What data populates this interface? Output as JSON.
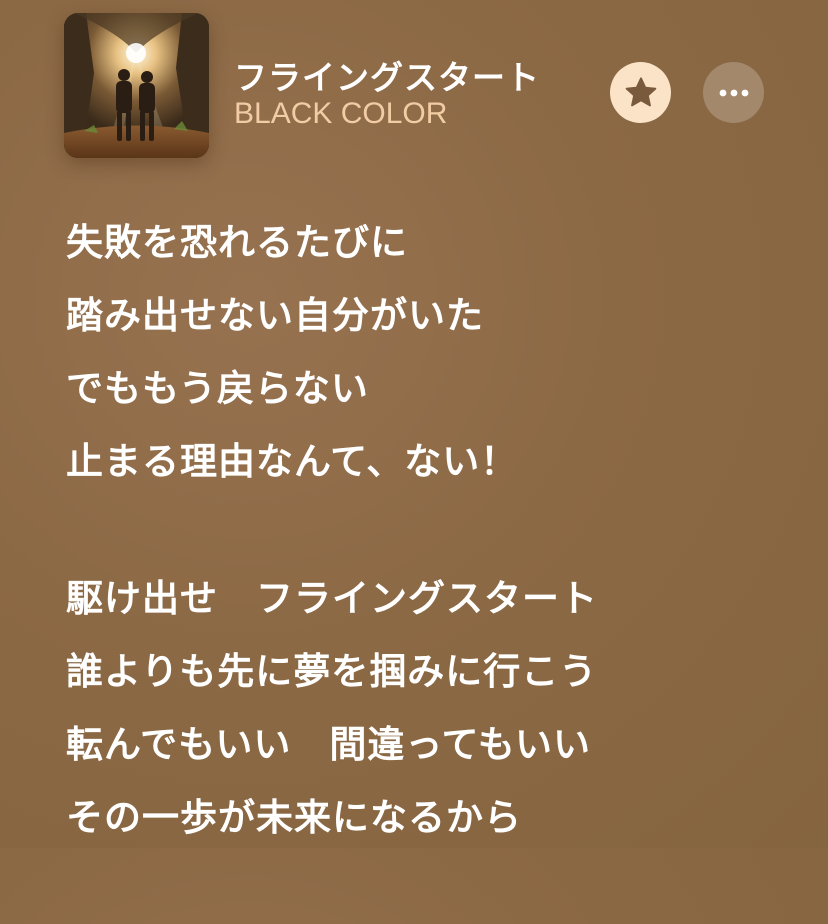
{
  "track": {
    "title": "フライングスタート",
    "artist": "BLACK COLOR"
  },
  "icons": {
    "favorite": "star-icon",
    "more": "ellipsis-icon"
  },
  "colors": {
    "background": "#8c6945",
    "artist_text": "#f1cca4",
    "favorite_button": "#fae3c6",
    "favorite_icon": "#7a5a3c",
    "lyric_text": "#ffffff"
  },
  "lyrics": {
    "stanza1": [
      "失敗を恐れるたびに",
      "踏み出せない自分がいた",
      "でももう戻らない",
      "止まる理由なんて、ない！"
    ],
    "stanza2": [
      "駆け出せ　フライングスタート",
      "誰よりも先に夢を掴みに行こう",
      "転んでもいい　間違ってもいい",
      "その一歩が未来になるから"
    ]
  }
}
